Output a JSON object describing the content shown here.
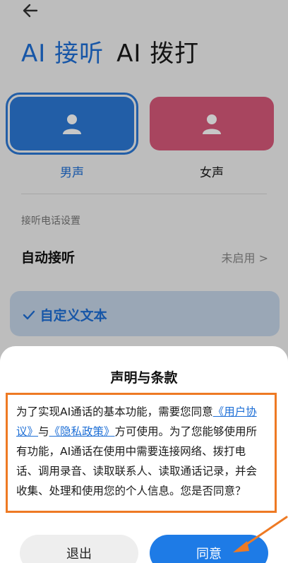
{
  "header": {
    "back_icon": "arrow-left-icon"
  },
  "tabs": [
    {
      "label": "AI 接听",
      "active": true
    },
    {
      "label": "AI 拨打",
      "active": false
    }
  ],
  "voice_options": {
    "male": {
      "label": "男声",
      "selected": true,
      "icon": "person-icon"
    },
    "female": {
      "label": "女声",
      "selected": false,
      "icon": "person-icon"
    }
  },
  "settings": {
    "section_title": "接听电话设置",
    "auto_answer": {
      "label": "自动接听",
      "value": "未启用 >"
    },
    "custom_text": {
      "label": "自定义文本",
      "icon": "check-icon"
    }
  },
  "dialog": {
    "title": "声明与条款",
    "body": {
      "p1": "为了实现AI通话的基本功能，需要您同意",
      "link_user_agreement": "《用户协议》",
      "p2": "与",
      "link_privacy": "《隐私政策》",
      "p3": "方可使用。为了您能够使用所有功能，AI通话在使用中需要连接网络、拨打电话、调用录音、读取联系人、读取通话记录，并会收集、处理和使用您的个人信息。您是否同意？"
    },
    "buttons": {
      "exit": "退出",
      "agree": "同意"
    }
  },
  "colors": {
    "accent": "#1e6fd6",
    "male_card": "#2c79d6",
    "female_card": "#d8597a",
    "highlight": "#ee7a24"
  }
}
